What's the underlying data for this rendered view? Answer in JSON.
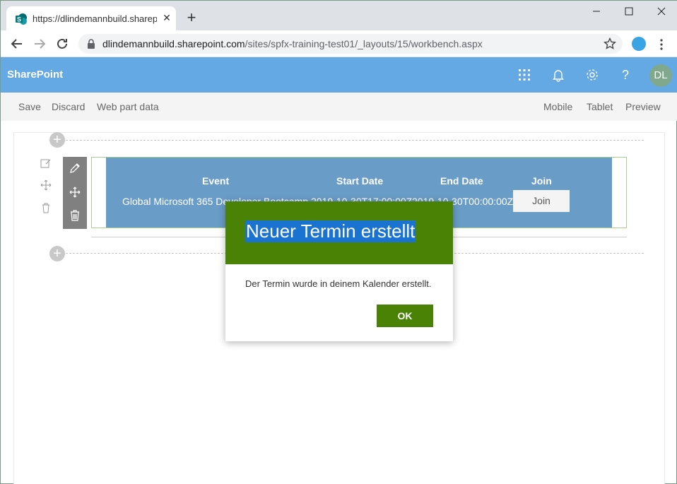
{
  "browser": {
    "tab_title": "https://dlindemannbuild.sharepo",
    "url_host": "dlindemannbuild.sharepoint.com",
    "url_path": "/sites/spfx-training-test01/_layouts/15/workbench.aspx"
  },
  "suitebar": {
    "title": "SharePoint",
    "avatar_initials": "DL",
    "help_glyph": "?"
  },
  "commandbar": {
    "left": [
      "Save",
      "Discard",
      "Web part data"
    ],
    "right": [
      "Mobile",
      "Tablet",
      "Preview"
    ]
  },
  "webpart": {
    "headers": [
      "Event",
      "Start Date",
      "End Date",
      "Join"
    ],
    "row": {
      "event": "Global Microsoft 365 Developer Bootcamp",
      "start": "2019-10-30T17:00:00Z",
      "end": "2019-10-30T00:00:00Z",
      "join_label": "Join"
    }
  },
  "dialog": {
    "title": "Neuer Termin erstellt",
    "message": "Der Termin wurde in deinem Kalender erstellt.",
    "ok_label": "OK"
  },
  "colors": {
    "suitebar": "#64a8e4",
    "dialog_accent": "#498205",
    "webpart_bg": "#6a9cc8"
  }
}
